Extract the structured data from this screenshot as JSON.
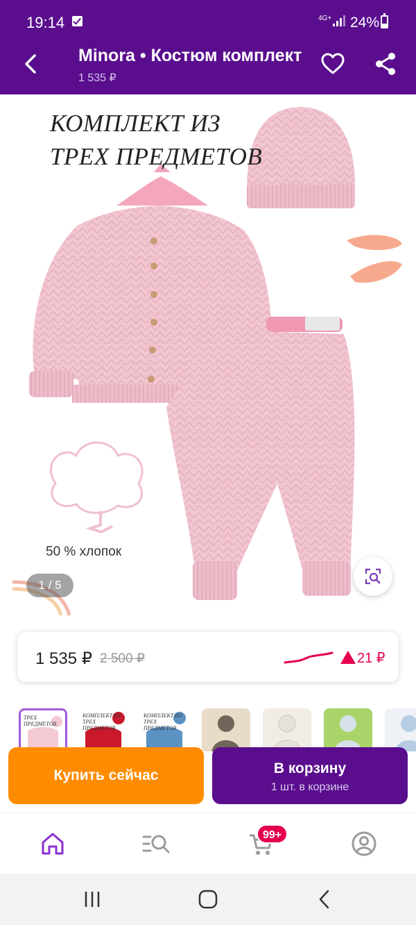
{
  "status_bar": {
    "time": "19:14",
    "network": "4G+",
    "battery": "24%",
    "icons": [
      "check-notification-icon",
      "signal-icon",
      "battery-icon"
    ]
  },
  "app_bar": {
    "title": "Minora • Костюм комплект",
    "subtitle": "1 535 ₽",
    "icons": [
      "back-arrow-icon",
      "heart-icon",
      "share-icon"
    ]
  },
  "gallery": {
    "promo_title_line1": "КОМПЛЕКТ ИЗ",
    "promo_title_line2": "ТРЕХ ПРЕДМЕТОВ",
    "cotton_text": "50 % хлопок",
    "counter": "1 / 5",
    "icons": [
      "image-search-icon",
      "cotton-icon"
    ]
  },
  "price_card": {
    "price": "1 535 ₽",
    "old_price": "2 500 ₽",
    "delta": "21 ₽",
    "colors": {
      "delta": "#e5004f",
      "trend_line": "#e5004f"
    }
  },
  "thumbnails": [
    {
      "caption": "ТРЕХ ПРЕДМЕТОВ",
      "color": "#f3c9d2",
      "active": true
    },
    {
      "caption": "КОМПЛЕКТ ИЗ ТРЕХ ПРЕДМЕТОВ",
      "color": "#c9192a",
      "active": false
    },
    {
      "caption": "КОМПЛЕКТ ИЗ ТРЕХ ПРЕДМЕТОВ",
      "color": "#5b92c4",
      "active": false
    },
    {
      "caption": "",
      "color": "#6f6558",
      "active": false
    },
    {
      "caption": "",
      "color": "#e6e1da",
      "active": false
    },
    {
      "caption": "",
      "color": "#d8e1ea",
      "active": false
    },
    {
      "caption": "",
      "color": "#b6cde4",
      "active": false
    }
  ],
  "actions": {
    "buy_now": "Купить сейчас",
    "to_cart": "В корзину",
    "to_cart_sub": "1 шт. в корзине",
    "colors": {
      "buy_now": "#ff8c00",
      "to_cart": "#5a0e8e"
    }
  },
  "bottom_nav": {
    "cart_badge": "99+",
    "icons": [
      "home-icon",
      "catalog-search-icon",
      "cart-icon",
      "profile-icon"
    ]
  },
  "system_nav": {
    "icons": [
      "recent-apps-icon",
      "home-button-icon",
      "back-icon"
    ]
  },
  "theme": {
    "primary": "#5a0e8e",
    "accent_pink": "#f3c9d2"
  }
}
